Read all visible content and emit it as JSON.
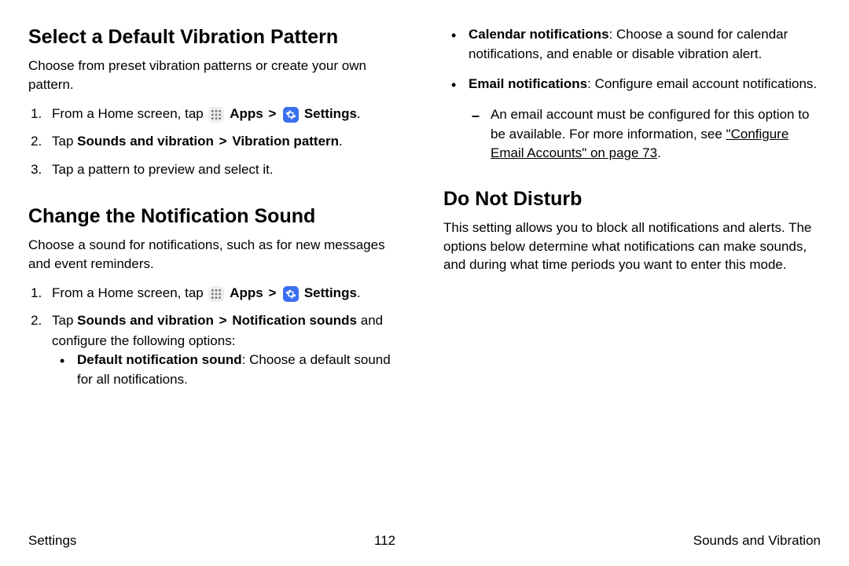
{
  "col1": {
    "h1": "Select a Default Vibration Pattern",
    "p1": "Choose from preset vibration patterns or create your own pattern.",
    "step_from_home": "From a Home screen, tap ",
    "apps_label": "Apps",
    "settings_label": "Settings",
    "step2a": "Tap ",
    "step2b": "Sounds and vibration",
    "step2c": "Vibration pattern",
    "step3": "Tap a pattern to preview and select it.",
    "h2": "Change the Notification Sound",
    "p2": "Choose a sound for notifications, such as for new messages and event reminders.",
    "s2step2a": "Tap ",
    "s2step2b": "Sounds and vibration",
    "s2step2c": "Notification sounds",
    "s2step2d": " and configure the following options:",
    "bullet1a": "Default notification sound",
    "bullet1b": ": Choose a default sound for all notifications."
  },
  "col2": {
    "b1a": "Calendar notifications",
    "b1b": ": Choose a sound for calendar notifications, and enable or disable vibration alert.",
    "b2a": "Email notifications",
    "b2b": ": Configure email account notifications.",
    "sub1a": "An email account must be configured for this option to be available. For more information, see ",
    "sub1link": "\"Configure Email Accounts\" on page 73",
    "h3": "Do Not Disturb",
    "p3": "This setting allows you to block all notifications and alerts. The options below determine what notifications can make sounds, and during what time periods you want to enter this mode."
  },
  "footer": {
    "left": "Settings",
    "center": "112",
    "right": "Sounds and Vibration"
  },
  "punct": {
    "period": ".",
    "chevron": ">"
  }
}
